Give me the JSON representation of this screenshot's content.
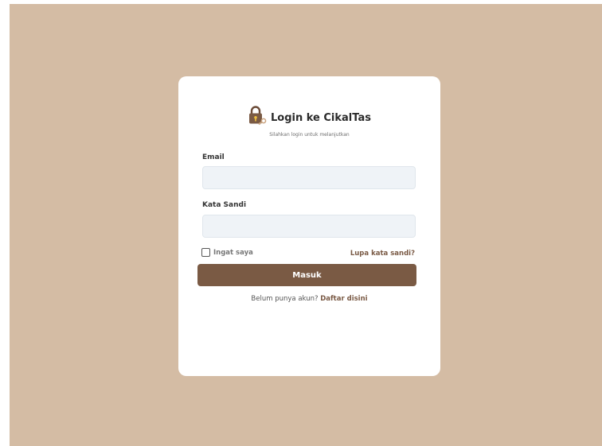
{
  "theme": {
    "background": "#d4bca4",
    "card": "#ffffff",
    "accent": "#7a5a44",
    "input_bg": "#eff3f7"
  },
  "header": {
    "icon": "lock-with-key-icon",
    "title": "Login ke CikalTas",
    "subtitle": "Silahkan login untuk melanjutkan"
  },
  "form": {
    "email_label": "Email",
    "email_value": "",
    "password_label": "Kata Sandi",
    "password_value": "",
    "remember_label": "Ingat saya",
    "remember_checked": false,
    "forgot_link": "Lupa kata sandi?",
    "submit_label": "Masuk"
  },
  "footer": {
    "prompt": "Belum punya akun?",
    "register_link": "Daftar disini"
  }
}
